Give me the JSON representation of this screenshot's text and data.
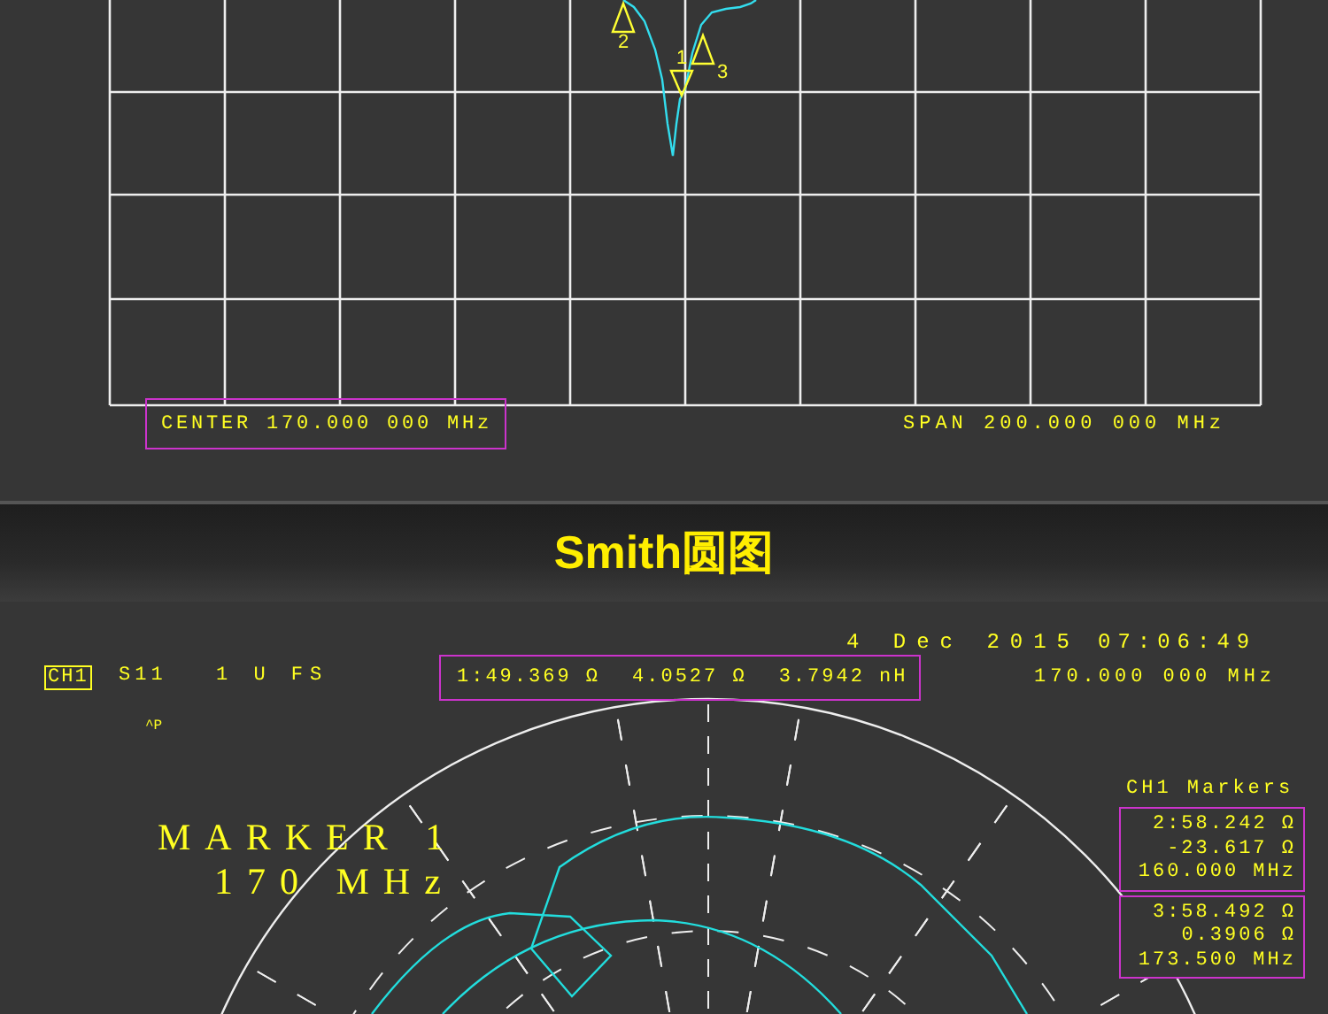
{
  "sweep_panel": {
    "markers": [
      {
        "label": "2",
        "kind": "up"
      },
      {
        "label": "1",
        "kind": "down"
      },
      {
        "label": "3",
        "kind": "up"
      }
    ],
    "center": "CENTER 170.000 000 MHz",
    "span": "SPAN 200.000 000 MHz"
  },
  "banner": {
    "title": "Smith圆图"
  },
  "smith_panel": {
    "date": "4 Dec 2015",
    "time": "07:06:49",
    "channel": "CH1",
    "parameter": "S11",
    "scale": "1 U FS",
    "flag": "^P",
    "readout": [
      "1:49.369 Ω",
      "4.0527 Ω",
      "3.7942 nH"
    ],
    "frequency": "170.000 000 MHz",
    "marker_title": "MARKER 1",
    "marker_freq": "170 MHz",
    "markers_heading": "CH1 Markers",
    "marker_boxes": [
      {
        "lines": [
          "2:58.242 Ω",
          "-23.617 Ω",
          "160.000 MHz"
        ]
      },
      {
        "lines": [
          "3:58.492 Ω",
          "0.3906 Ω",
          "173.500 MHz"
        ]
      }
    ]
  }
}
